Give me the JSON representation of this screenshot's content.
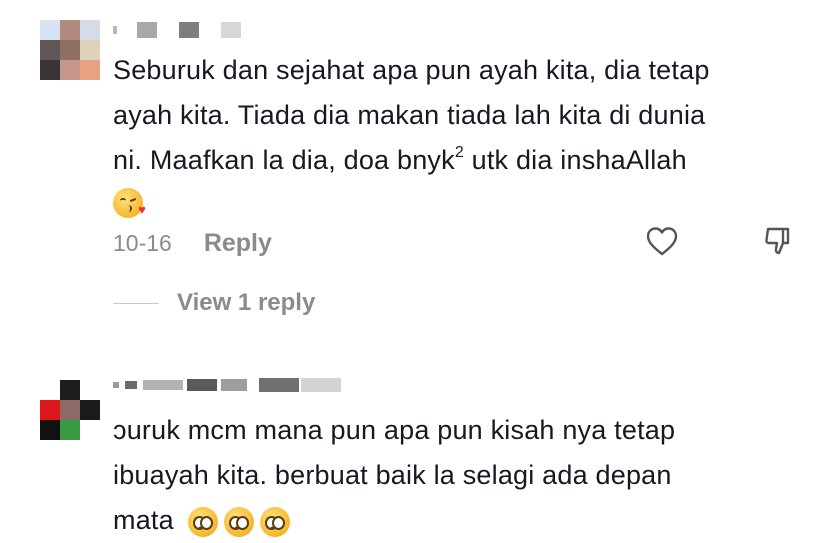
{
  "comments": [
    {
      "text_lines": [
        "Seburuk dan sejahat apa pun ayah kita, dia tetap",
        "ayah kita. Tiada dia makan tiada lah kita di dunia",
        "ni. Maafkan la dia, doa bnyk"
      ],
      "line3_sup": "2",
      "line3_tail": " utk dia inshaAllah",
      "emoji": "kissing-heart",
      "date": "10-16",
      "reply_label": "Reply",
      "view_replies_label": "View 1 reply"
    },
    {
      "text_lines": [
        "ɔuruk mcm mana pun apa pun kisah nya tetap",
        "ibuayah kita. berbuat baik la selagi ada depan",
        "mata"
      ],
      "emojis": [
        "pleading-face",
        "pleading-face",
        "pleading-face"
      ]
    }
  ],
  "icons": {
    "like": "heart-outline-icon",
    "dislike": "thumbs-down-icon"
  },
  "colors": {
    "text": "#161823",
    "secondary": "#8a8b91",
    "divider": "#c8c8cc"
  }
}
